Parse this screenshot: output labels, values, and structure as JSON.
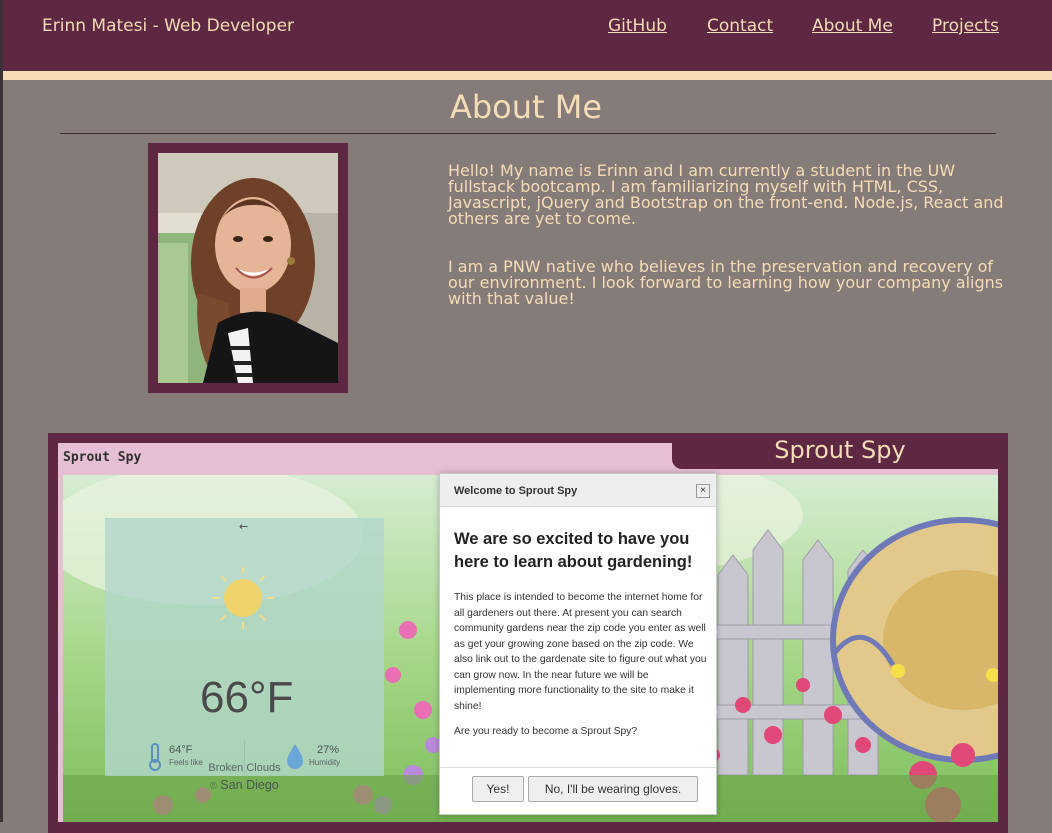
{
  "nav": {
    "brand": "Erinn Matesi - Web Developer",
    "links": [
      "GitHub",
      "Contact",
      "About Me",
      "Projects"
    ]
  },
  "about": {
    "title": "About Me",
    "bio": [
      "Hello! My name is Erinn and I am currently a student in the UW fullstack bootcamp. I am familiarizing myself with HTML, CSS, Javascript, jQuery and Bootstrap on the front-end. Node.js, React and others are yet to come.",
      "I am a PNW native who believes in the preservation and recovery of our environment. I look forward to learning how your company aligns with that value!"
    ]
  },
  "project": {
    "title": "Sprout Spy",
    "screenshot": {
      "brand": "Sprout Spy",
      "weather": {
        "temp": "66°F",
        "description": "Broken Clouds",
        "city": "San Diego",
        "feels_like_value": "64°F",
        "feels_like_label": "Feels like",
        "humidity_value": "27%",
        "humidity_label": "Humidity"
      },
      "modal": {
        "title": "Welcome to Sprout Spy",
        "close": "×",
        "heading": "We are so excited to have you here to learn about gardening!",
        "body": "This place is intended to become the internet home for all gardeners out there. At present you can search community gardens near the zip code you enter as well as get your growing zone based on the zip code. We also link out to the gardenate site to figure out what you can grow now. In the near future we will be implementing more functionality to the site to make it shine!",
        "question": "Are you ready to become a Sprout Spy?",
        "yes": "Yes!",
        "no": "No, I'll be wearing gloves."
      }
    }
  },
  "colors": {
    "nav_bg": "#5e2842",
    "accent_text": "#f4dcb6",
    "page_bg": "#857c79"
  }
}
